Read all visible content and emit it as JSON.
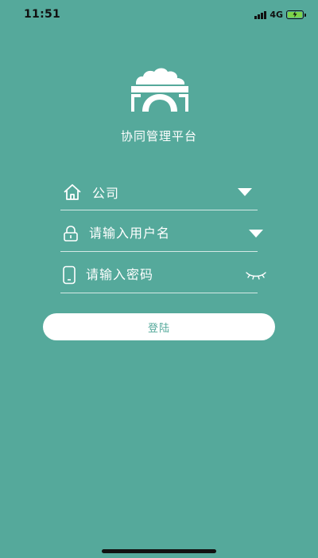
{
  "status_bar": {
    "time": "11:51",
    "network": "4G"
  },
  "app": {
    "title": "协同管理平台",
    "logo_icon": "platform-logo"
  },
  "form": {
    "company": {
      "label": "公司",
      "icon": "home-icon",
      "trail_icon": "caret-down-icon"
    },
    "username": {
      "placeholder": "请输入用户名",
      "icon": "lock-icon",
      "trail_icon": "caret-down-icon"
    },
    "password": {
      "placeholder": "请输入密码",
      "icon": "phone-icon",
      "trail_icon": "eye-closed-icon"
    },
    "login_label": "登陆"
  },
  "colors": {
    "background": "#55a99b",
    "foreground": "#ffffff",
    "battery": "#7dd34a"
  }
}
